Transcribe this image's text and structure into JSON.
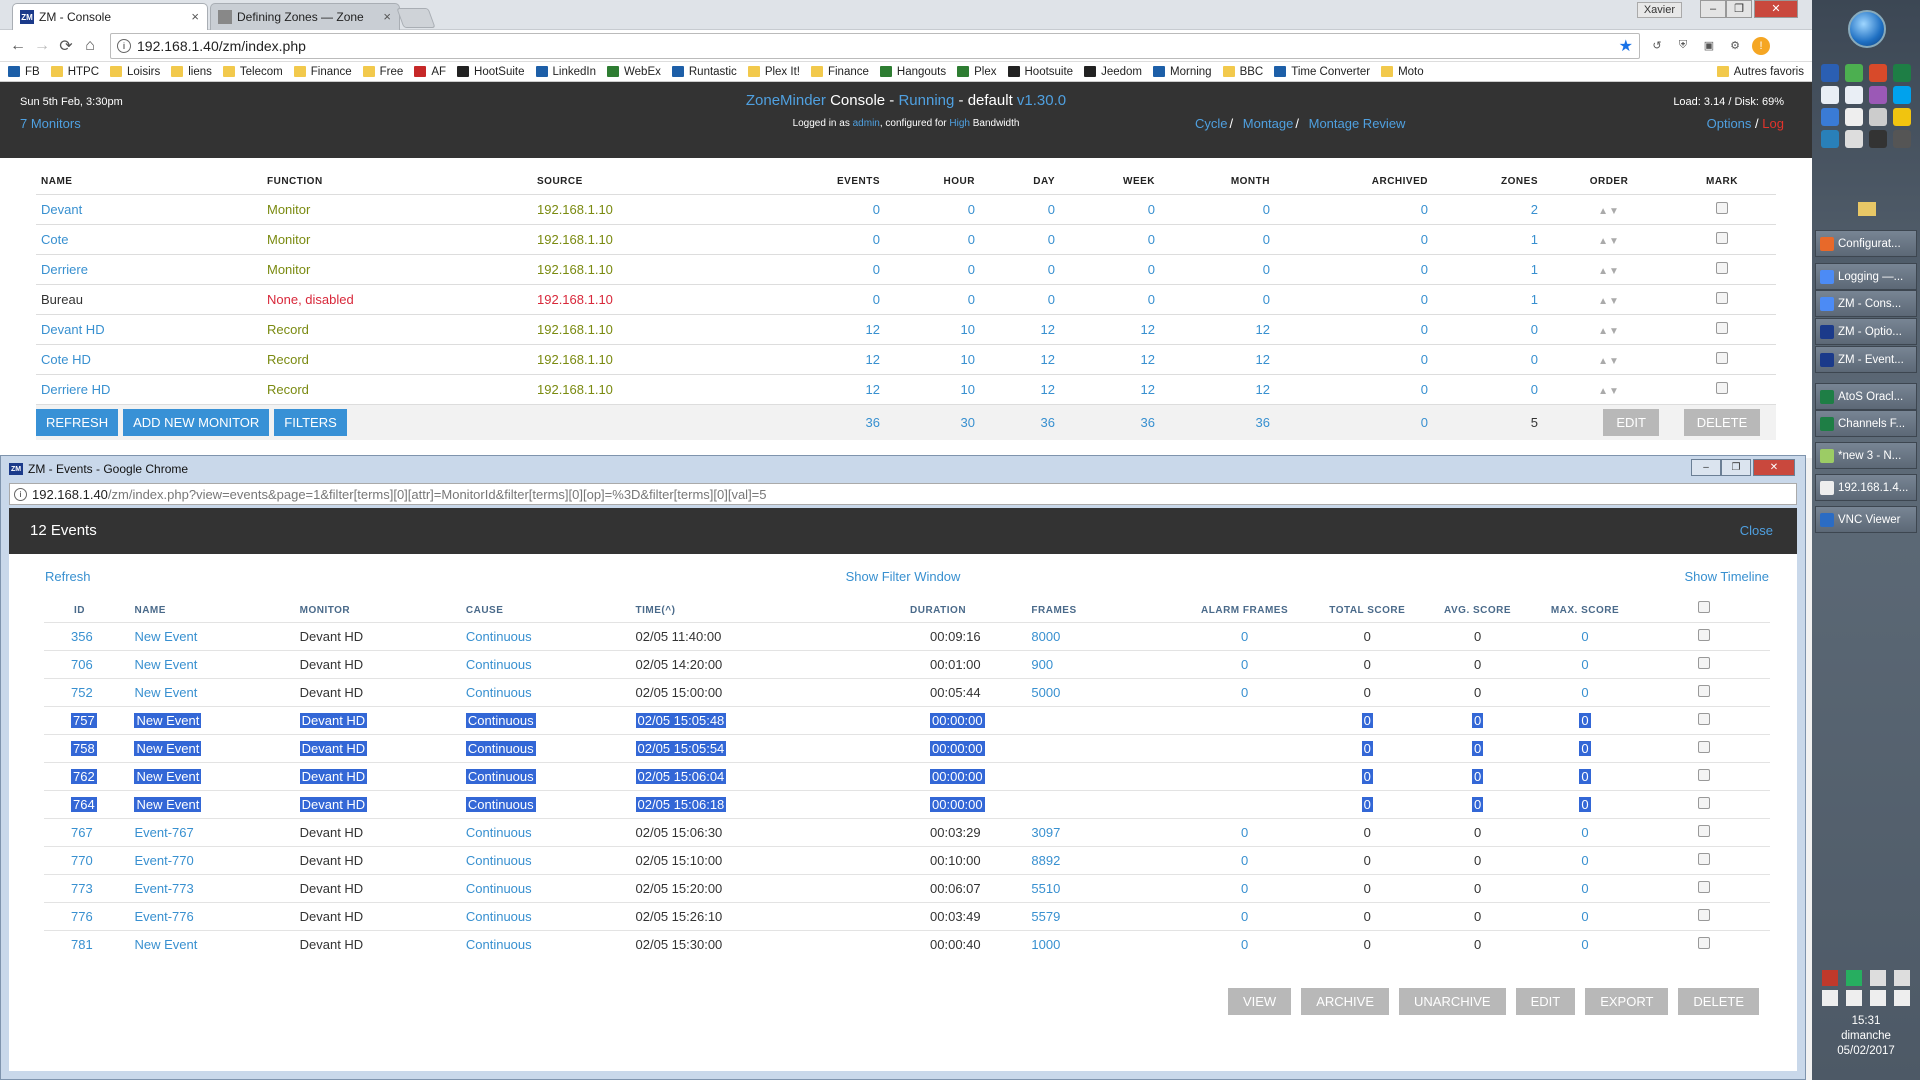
{
  "browser": {
    "tabs": [
      {
        "label": "ZM - Console",
        "active": true
      },
      {
        "label": "Defining Zones — Zone",
        "active": false
      }
    ],
    "user": "Xavier",
    "url": "192.168.1.40/zm/index.php",
    "bookmarks": [
      "FB",
      "HTPC",
      "Loisirs",
      "liens",
      "Telecom",
      "Finance",
      "Free",
      "AF",
      "HootSuite",
      "LinkedIn",
      "WebEx",
      "Runtastic",
      "Plex It!",
      "Finance",
      "Hangouts",
      "Plex",
      "Hootsuite",
      "Jeedom",
      "Morning",
      "BBC",
      "Time Converter",
      "Moto"
    ],
    "bookmarks_other": "Autres favoris"
  },
  "zm": {
    "date": "Sun 5th Feb, 3:30pm",
    "monitors_link": "7 Monitors",
    "title_app": "ZoneMinder",
    "title_console": "Console",
    "title_status": "Running",
    "title_sep": "-",
    "title_default": "default",
    "title_version": "v1.30.0",
    "login_prefix": "Logged in as",
    "login_user": "admin",
    "login_mid": ", configured for",
    "login_bw": "High",
    "login_suffix": "Bandwidth",
    "load": "Load: 3.14 / Disk: 69%",
    "links": {
      "cycle": "Cycle",
      "montage": "Montage",
      "montage_review": "Montage Review",
      "sep": "/"
    },
    "options": "Options",
    "log": "Log"
  },
  "console": {
    "headers": [
      "NAME",
      "FUNCTION",
      "SOURCE",
      "EVENTS",
      "HOUR",
      "DAY",
      "WEEK",
      "MONTH",
      "ARCHIVED",
      "ZONES",
      "ORDER",
      "MARK"
    ],
    "rows": [
      {
        "name": "Devant",
        "function": "Monitor",
        "source": "192.168.1.10",
        "events": "0",
        "hour": "0",
        "day": "0",
        "week": "0",
        "month": "0",
        "archived": "0",
        "zones": "2",
        "status": "monitor"
      },
      {
        "name": "Cote",
        "function": "Monitor",
        "source": "192.168.1.10",
        "events": "0",
        "hour": "0",
        "day": "0",
        "week": "0",
        "month": "0",
        "archived": "0",
        "zones": "1",
        "status": "monitor"
      },
      {
        "name": "Derriere",
        "function": "Monitor",
        "source": "192.168.1.10",
        "events": "0",
        "hour": "0",
        "day": "0",
        "week": "0",
        "month": "0",
        "archived": "0",
        "zones": "1",
        "status": "monitor"
      },
      {
        "name": "Bureau",
        "function": "None, disabled",
        "source": "192.168.1.10",
        "events": "0",
        "hour": "0",
        "day": "0",
        "week": "0",
        "month": "0",
        "archived": "0",
        "zones": "1",
        "status": "disabled"
      },
      {
        "name": "Devant HD",
        "function": "Record",
        "source": "192.168.1.10",
        "events": "12",
        "hour": "10",
        "day": "12",
        "week": "12",
        "month": "12",
        "archived": "0",
        "zones": "0",
        "status": "record"
      },
      {
        "name": "Cote HD",
        "function": "Record",
        "source": "192.168.1.10",
        "events": "12",
        "hour": "10",
        "day": "12",
        "week": "12",
        "month": "12",
        "archived": "0",
        "zones": "0",
        "status": "record"
      },
      {
        "name": "Derriere HD",
        "function": "Record",
        "source": "192.168.1.10",
        "events": "12",
        "hour": "10",
        "day": "12",
        "week": "12",
        "month": "12",
        "archived": "0",
        "zones": "0",
        "status": "record"
      }
    ],
    "totals": {
      "events": "36",
      "hour": "30",
      "day": "36",
      "week": "36",
      "month": "36",
      "archived": "0",
      "zones": "5"
    },
    "buttons": {
      "refresh": "REFRESH",
      "add": "ADD NEW MONITOR",
      "filters": "FILTERS",
      "edit": "EDIT",
      "delete": "DELETE"
    }
  },
  "events": {
    "window_title": "ZM - Events - Google Chrome",
    "url_host": "192.168.1.40",
    "url_path": "/zm/index.php?view=events&page=1&filter[terms][0][attr]=MonitorId&filter[terms][0][op]=%3D&filter[terms][0][val]=5",
    "count": "12 Events",
    "close": "Close",
    "refresh": "Refresh",
    "show_filter": "Show Filter Window",
    "show_timeline": "Show Timeline",
    "headers": {
      "id": "ID",
      "name": "NAME",
      "monitor": "MONITOR",
      "cause": "CAUSE",
      "time": "TIME(^)",
      "duration": "DURATION",
      "frames": "FRAMES",
      "alarm_frames": "ALARM FRAMES",
      "total_score": "TOTAL SCORE",
      "avg_score": "AVG. SCORE",
      "max_score": "MAX. SCORE"
    },
    "rows": [
      {
        "id": "356",
        "name": "New Event",
        "monitor": "Devant HD",
        "cause": "Continuous",
        "time": "02/05 11:40:00",
        "duration": "00:09:16",
        "frames": "8000",
        "alarm": "0",
        "total": "0",
        "avg": "0",
        "max": "0",
        "selected": false
      },
      {
        "id": "706",
        "name": "New Event",
        "monitor": "Devant HD",
        "cause": "Continuous",
        "time": "02/05 14:20:00",
        "duration": "00:01:00",
        "frames": "900",
        "alarm": "0",
        "total": "0",
        "avg": "0",
        "max": "0",
        "selected": false
      },
      {
        "id": "752",
        "name": "New Event",
        "monitor": "Devant HD",
        "cause": "Continuous",
        "time": "02/05 15:00:00",
        "duration": "00:05:44",
        "frames": "5000",
        "alarm": "0",
        "total": "0",
        "avg": "0",
        "max": "0",
        "selected": false
      },
      {
        "id": "757",
        "name": "New Event",
        "monitor": "Devant HD",
        "cause": "Continuous",
        "time": "02/05 15:05:48",
        "duration": "00:00:00",
        "frames": "",
        "alarm": "",
        "total": "0",
        "avg": "0",
        "max": "0",
        "selected": true
      },
      {
        "id": "758",
        "name": "New Event",
        "monitor": "Devant HD",
        "cause": "Continuous",
        "time": "02/05 15:05:54",
        "duration": "00:00:00",
        "frames": "",
        "alarm": "",
        "total": "0",
        "avg": "0",
        "max": "0",
        "selected": true
      },
      {
        "id": "762",
        "name": "New Event",
        "monitor": "Devant HD",
        "cause": "Continuous",
        "time": "02/05 15:06:04",
        "duration": "00:00:00",
        "frames": "",
        "alarm": "",
        "total": "0",
        "avg": "0",
        "max": "0",
        "selected": true
      },
      {
        "id": "764",
        "name": "New Event",
        "monitor": "Devant HD",
        "cause": "Continuous",
        "time": "02/05 15:06:18",
        "duration": "00:00:00",
        "frames": "",
        "alarm": "",
        "total": "0",
        "avg": "0",
        "max": "0",
        "selected": true
      },
      {
        "id": "767",
        "name": "Event-767",
        "monitor": "Devant HD",
        "cause": "Continuous",
        "time": "02/05 15:06:30",
        "duration": "00:03:29",
        "frames": "3097",
        "alarm": "0",
        "total": "0",
        "avg": "0",
        "max": "0",
        "selected": false
      },
      {
        "id": "770",
        "name": "Event-770",
        "monitor": "Devant HD",
        "cause": "Continuous",
        "time": "02/05 15:10:00",
        "duration": "00:10:00",
        "frames": "8892",
        "alarm": "0",
        "total": "0",
        "avg": "0",
        "max": "0",
        "selected": false
      },
      {
        "id": "773",
        "name": "Event-773",
        "monitor": "Devant HD",
        "cause": "Continuous",
        "time": "02/05 15:20:00",
        "duration": "00:06:07",
        "frames": "5510",
        "alarm": "0",
        "total": "0",
        "avg": "0",
        "max": "0",
        "selected": false
      },
      {
        "id": "776",
        "name": "Event-776",
        "monitor": "Devant HD",
        "cause": "Continuous",
        "time": "02/05 15:26:10",
        "duration": "00:03:49",
        "frames": "5579",
        "alarm": "0",
        "total": "0",
        "avg": "0",
        "max": "0",
        "selected": false
      },
      {
        "id": "781",
        "name": "New Event",
        "monitor": "Devant HD",
        "cause": "Continuous",
        "time": "02/05 15:30:00",
        "duration": "00:00:40",
        "frames": "1000",
        "alarm": "0",
        "total": "0",
        "avg": "0",
        "max": "0",
        "selected": false
      }
    ],
    "buttons": [
      "VIEW",
      "ARCHIVE",
      "UNARCHIVE",
      "EDIT",
      "EXPORT",
      "DELETE"
    ]
  },
  "taskbar": {
    "items": [
      "Configurat...",
      "Logging —...",
      "ZM - Cons...",
      "ZM - Optio...",
      "ZM - Event...",
      "AtoS Oracl...",
      "Channels F...",
      "*new 3 - N...",
      "192.168.1.4...",
      "VNC Viewer"
    ],
    "time": "15:31",
    "day": "dimanche",
    "date": "05/02/2017"
  },
  "colors": {
    "accent": "#3890d0",
    "header_bg": "#333333",
    "record": "#7a8a10",
    "disabled": "#d8283a",
    "selection": "#3367d6"
  }
}
